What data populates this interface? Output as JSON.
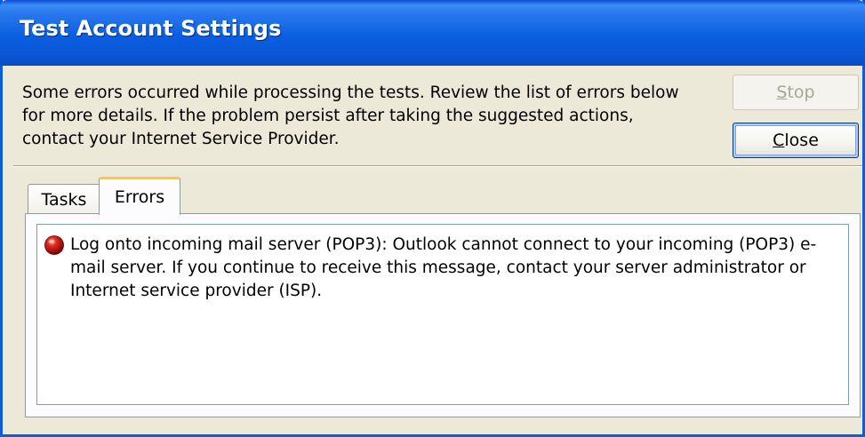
{
  "window": {
    "title": "Test Account Settings"
  },
  "message": "Some errors occurred while processing the tests. Review the list of errors below for more details. If the problem persist after taking the suggested actions, contact your Internet Service Provider.",
  "buttons": {
    "stop": {
      "accel": "S",
      "rest": "top",
      "enabled": false
    },
    "close": {
      "accel": "C",
      "rest": "lose",
      "enabled": true
    }
  },
  "tabs": [
    {
      "label": "Tasks",
      "selected": false
    },
    {
      "label": "Errors",
      "selected": true
    }
  ],
  "errors": [
    {
      "icon": "error-ball-icon",
      "text": "Log onto incoming mail server (POP3): Outlook cannot connect to your incoming (POP3) e-mail server. If you continue to receive this message, contact your server administrator or Internet service provider (ISP)."
    }
  ],
  "colors": {
    "titlebar": "#0a5fe0",
    "dialog_bg": "#ece9d8",
    "tab_highlight": "#ffc83c",
    "error_icon": "#c0140c"
  }
}
